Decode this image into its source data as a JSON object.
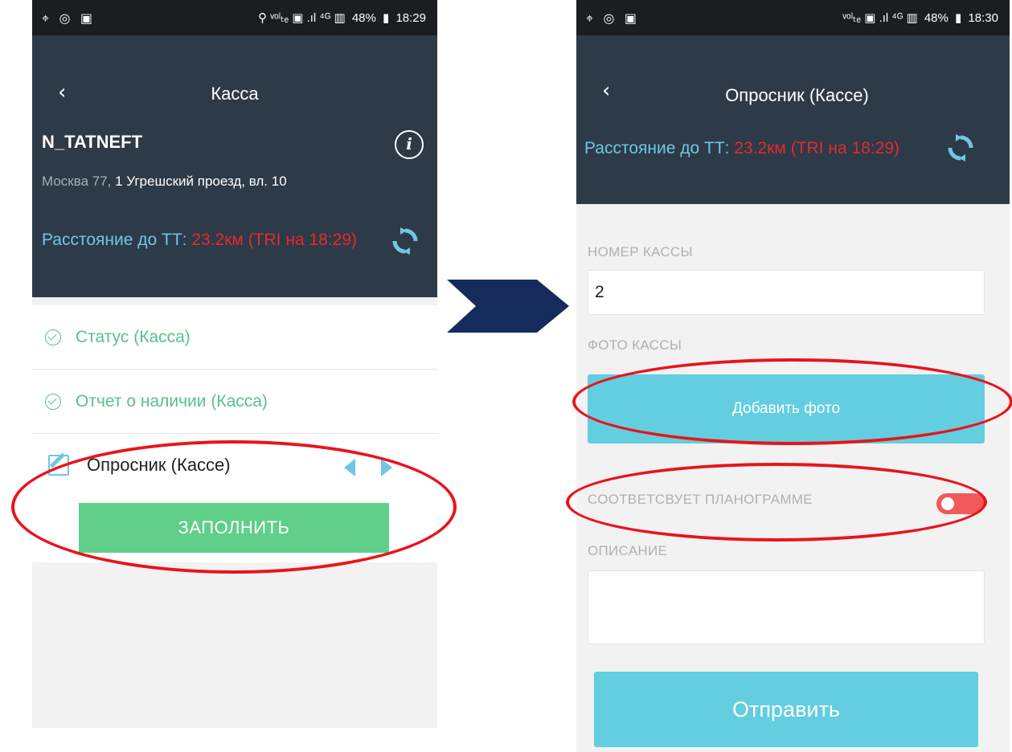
{
  "left_screen": {
    "statusbar": {
      "left_icons": "⌖ ◎ ▣",
      "signal": "⚲ ᵛᵒˡₜₑ ▣ .ıl ⁴ᴳ ▥",
      "battery": "48%",
      "time": "18:29"
    },
    "header": {
      "title": "Касса",
      "store_name": "N_TATNEFT",
      "address_city": "Москва 77,",
      "address_street": " 1 Угрешский проезд, вл. 10",
      "distance_label": "Расстояние до ТТ: ",
      "distance_value": "23.2км (TRI на 18:29)"
    },
    "list": {
      "items": [
        {
          "label": "Статус (Касса)",
          "state": "done"
        },
        {
          "label": "Отчет о наличии (Касса)",
          "state": "done"
        },
        {
          "label": "Опросник (Кассе)",
          "state": "active"
        }
      ],
      "fill_button": "ЗАПОЛНИТЬ"
    }
  },
  "right_screen": {
    "statusbar": {
      "left_icons": "⌖ ◎ ▣",
      "signal": "ᵛᵒˡₜₑ ▣ .ıl ⁴ᴳ ▥",
      "battery": "48%",
      "time": "18:30"
    },
    "header": {
      "title": "Опросник (Кассе)",
      "distance_label": "Расстояние до ТТ: ",
      "distance_value": "23.2км (TRI на 18:29)"
    },
    "form": {
      "number_label": "НОМЕР КАССЫ",
      "number_value": "2",
      "photo_label": "ФОТО КАССЫ",
      "photo_button": "Добавить фото",
      "planogram_label": "СООТВЕТСВУЕТ ПЛАНОГРАММЕ",
      "planogram_toggle_on": false,
      "description_label": "ОПИСАНИЕ",
      "description_value": "",
      "send_button": "Отправить"
    }
  },
  "colors": {
    "header_bg": "#2d3a48",
    "accent_green": "#59c08a",
    "accent_blue": "#63cee0",
    "distance_red": "#e42b2b",
    "toggle_off": "#f05a5a",
    "highlight_red": "#e8141c",
    "arrow_navy": "#142b5c"
  }
}
